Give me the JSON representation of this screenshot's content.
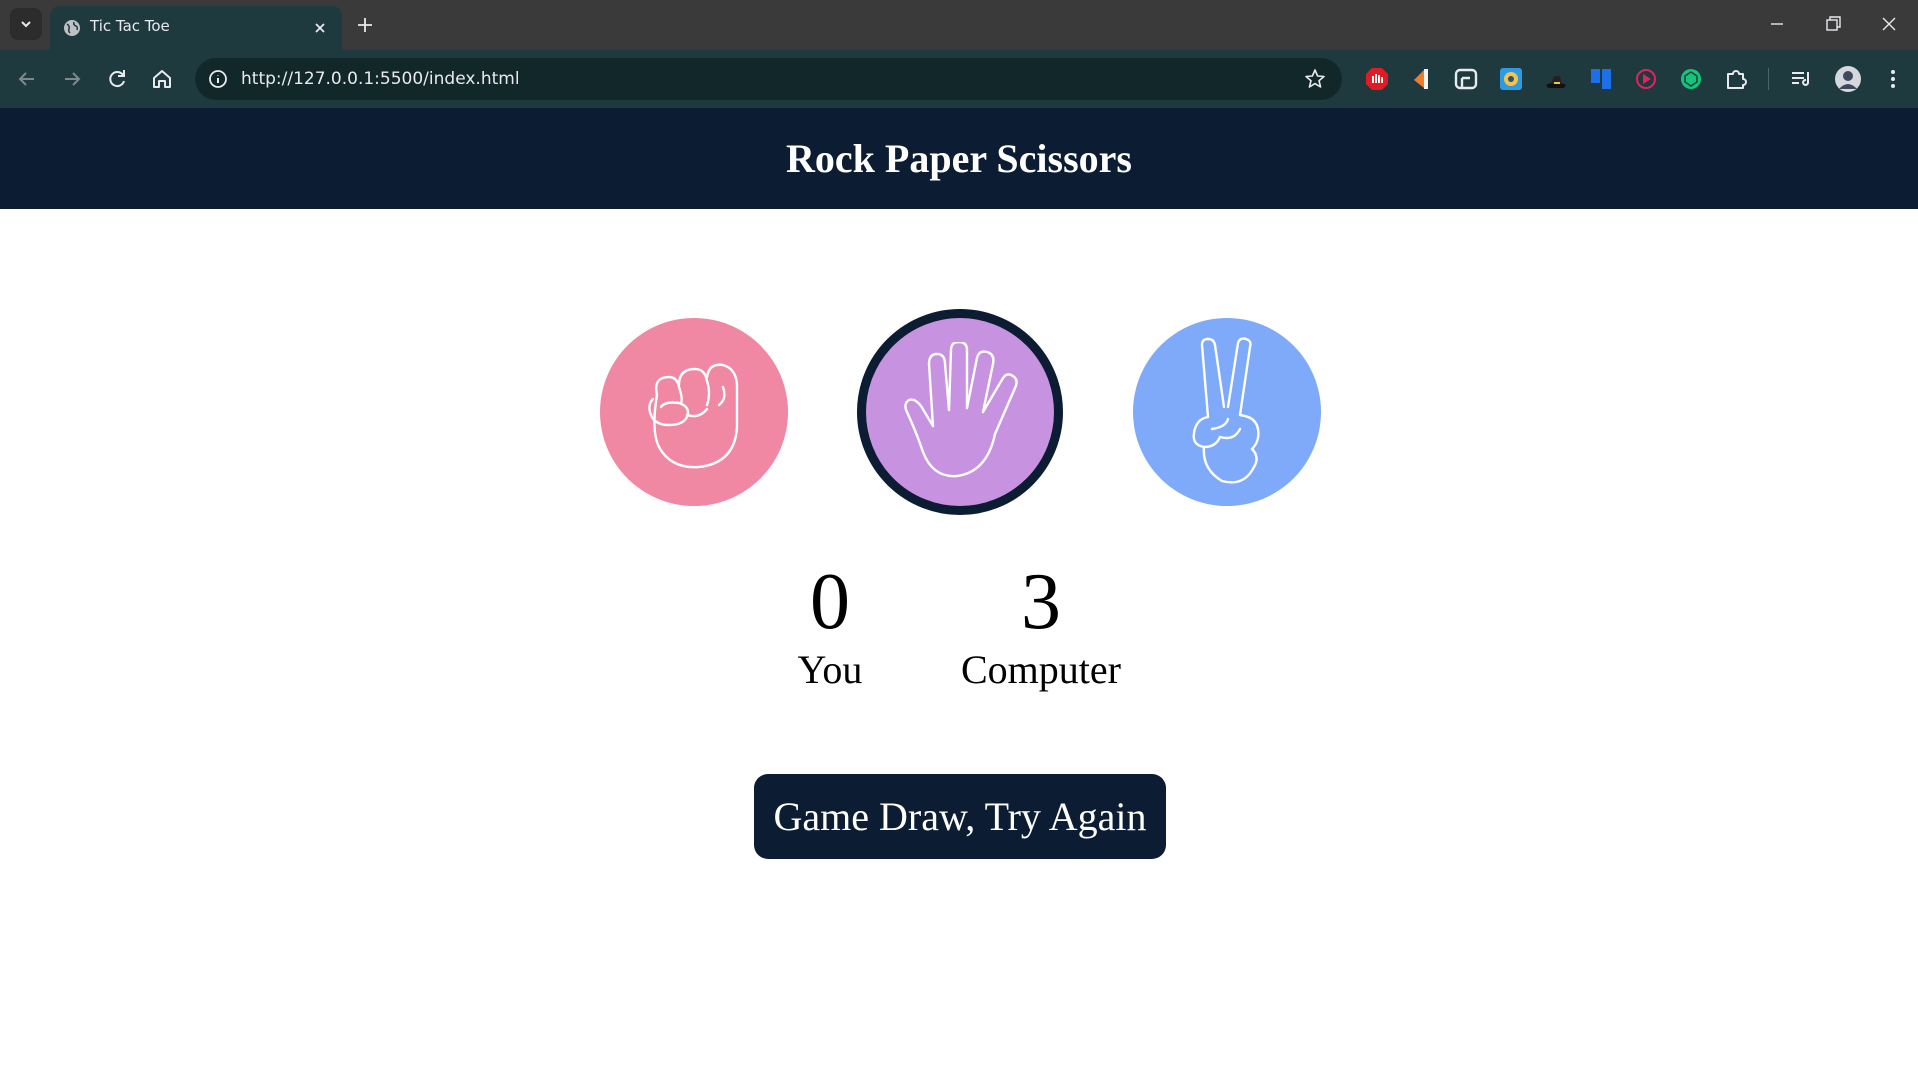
{
  "browser": {
    "tab_title": "Tic Tac Toe",
    "url": "http://127.0.0.1:5500/index.html",
    "colors": {
      "tabbar": "#3a3a3a",
      "toolbar": "#1e3a3e",
      "omnibox": "#12272a"
    },
    "extension_icons": [
      "adblock-icon",
      "pdf-tool-icon",
      "screen-capture-icon",
      "color-picker-icon",
      "dark-hat-icon",
      "trello-icon",
      "video-recorder-icon",
      "chatgpt-icon",
      "extensions-puzzle-icon",
      "reading-list-icon",
      "profile-avatar",
      "menu-dots-icon"
    ]
  },
  "page": {
    "title": "Rock Paper Scissors",
    "header_color": "#0b1c33",
    "choices": [
      {
        "name": "rock",
        "icon": "fist-icon",
        "color": "#f088a4"
      },
      {
        "name": "paper",
        "icon": "open-hand-icon",
        "color": "#c792df",
        "selected": true
      },
      {
        "name": "scissors",
        "icon": "peace-hand-icon",
        "color": "#7faaf9"
      }
    ],
    "score": {
      "user_score": "0",
      "user_label": "You",
      "computer_score": "3",
      "computer_label": "Computer"
    },
    "message": "Game Draw, Try Again",
    "message_color": "#0b1c33"
  }
}
